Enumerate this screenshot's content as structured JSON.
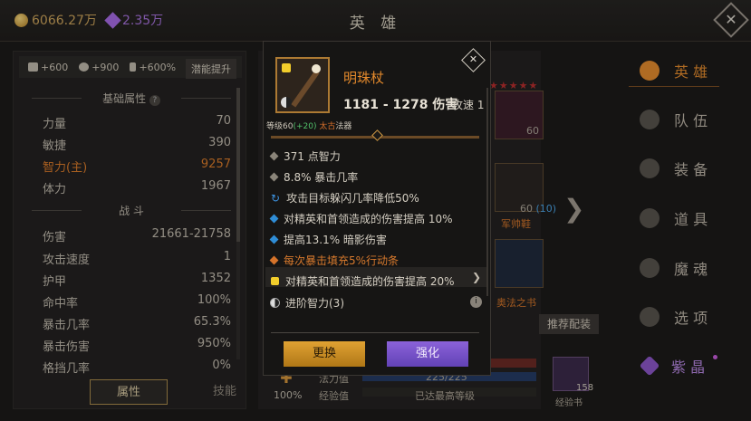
{
  "topbar": {
    "gold": "6066.27万",
    "gems": "2.35万",
    "title": "英 雄",
    "close_label": "✕"
  },
  "left_panel": {
    "bonus": [
      "+600",
      "+900",
      "+600%"
    ],
    "skill_button": "潜能提升",
    "section_basic": "基础属性",
    "basic": [
      {
        "k": "力量",
        "v": "70"
      },
      {
        "k": "敏捷",
        "v": "390"
      },
      {
        "k": "智力(主)",
        "v": "9257"
      },
      {
        "k": "体力",
        "v": "1967"
      }
    ],
    "section_combat": "战 斗",
    "combat": [
      {
        "k": "伤害",
        "v": "21661-21758"
      },
      {
        "k": "攻击速度",
        "v": "1"
      },
      {
        "k": "护甲",
        "v": "1352"
      },
      {
        "k": "命中率",
        "v": "100%"
      },
      {
        "k": "暴击几率",
        "v": "65.3%"
      },
      {
        "k": "暴击伤害",
        "v": "950%"
      },
      {
        "k": "格挡几率",
        "v": "0%"
      }
    ],
    "tabs": [
      "属性",
      "技能"
    ]
  },
  "middle": {
    "slot_values": [
      "60",
      "60",
      "(10)"
    ],
    "slot_names": [
      "军帅鞋",
      "奥法之书"
    ],
    "recommend": "推荐配装",
    "percent": "100%",
    "mana_label": "法力值",
    "mana_value": "225/225",
    "exp_label": "经验值",
    "exp_value": "已达最高等级",
    "book_count": "158",
    "book_label": "经验书"
  },
  "right_nav": {
    "items": [
      "英 雄",
      "队 伍",
      "装 备",
      "道 具",
      "魔 魂",
      "选 项",
      "紫 晶"
    ]
  },
  "popup": {
    "close_label": "✕",
    "name": "明珠杖",
    "damage": "1181 - 1278 伤害",
    "speed": "攻速 1",
    "level_prefix": "等级60",
    "level_bonus": "(+20)",
    "rarity": "太古",
    "category": "法器",
    "affixes": [
      "371 点智力",
      "8.8% 暴击几率",
      "攻击目标躲闪几率降低50%",
      "对精英和首领造成的伤害提高 10%",
      "提高13.1% 暗影伤害",
      "每次暴击填充5%行动条",
      "对精英和首领造成的伤害提高 20%"
    ],
    "advance": "进阶智力(3)",
    "info_label": "i",
    "btn_replace": "更换",
    "btn_upgrade": "强化"
  }
}
